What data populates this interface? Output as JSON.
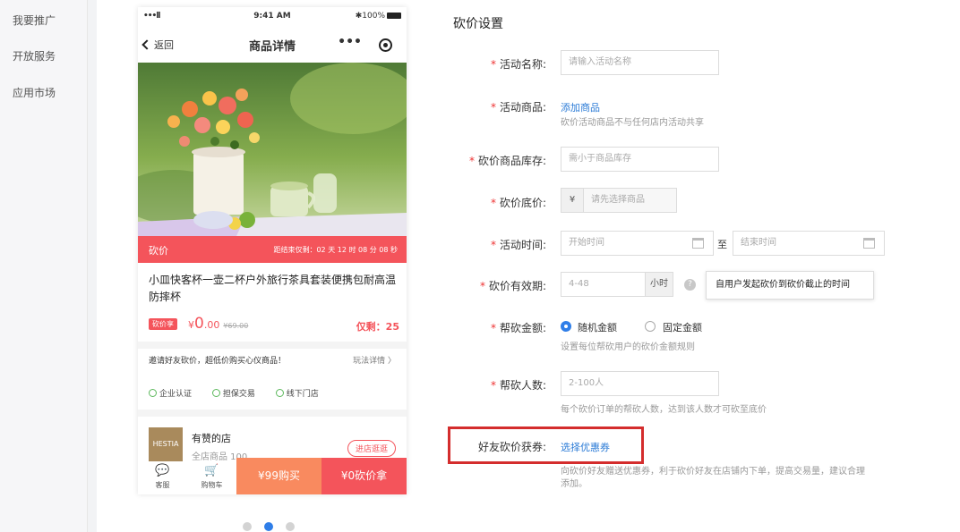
{
  "sidebar": {
    "items": [
      {
        "label": "我要推广"
      },
      {
        "label": "开放服务"
      },
      {
        "label": "应用市场"
      }
    ]
  },
  "phone": {
    "status": {
      "signal": "•••ll",
      "time": "9:41 AM",
      "battery": "✱100%"
    },
    "nav": {
      "back": "返回",
      "title": "商品详情",
      "more": "•••"
    },
    "bargain_bar": {
      "label": "砍价",
      "countdown": "距结束仅剩：02 天 12 时 08 分 08 秒"
    },
    "product_title": "小皿快客杯一壶二杯户外旅行茶具套装便携包耐高温防摔杯",
    "price": {
      "tag": "砍价享",
      "currency": "¥",
      "value": "0",
      "decimals": ".00",
      "original": "¥69.00"
    },
    "stock": "仅剩：25",
    "invite": {
      "text": "邀请好友砍价，超低价购买心仪商品！",
      "rule": "玩法详情  〉"
    },
    "badges": [
      "企业认证",
      "担保交易",
      "线下门店"
    ],
    "shop": {
      "logo": "HESTIA",
      "name": "有赞的店",
      "count": "全店商品 100",
      "button": "进店逛逛"
    },
    "bottom": {
      "service": "客服",
      "cart": "购物车",
      "buy_original": "¥99购买",
      "buy_bargain": "¥0砍价拿"
    }
  },
  "pager": {
    "count": 3,
    "active": 1
  },
  "form": {
    "title": "砍价设置",
    "activity_name": {
      "label": "活动名称:",
      "placeholder": "请输入活动名称"
    },
    "activity_product": {
      "label": "活动商品:",
      "link": "添加商品",
      "hint": "砍价活动商品不与任何店内活动共享"
    },
    "stock": {
      "label": "砍价商品库存:",
      "placeholder": "需小于商品库存"
    },
    "floor_price": {
      "label": "砍价底价:",
      "prefix": "¥",
      "placeholder": "请先选择商品"
    },
    "time": {
      "label": "活动时间:",
      "start": "开始时间",
      "to": "至",
      "end": "结束时间"
    },
    "validity": {
      "label": "砍价有效期:",
      "placeholder": "4-48",
      "unit": "小时",
      "help": "?",
      "tooltip": "自用户发起砍价到砍价截止的时间"
    },
    "amount": {
      "label": "帮砍金额:",
      "options": [
        "随机金额",
        "固定金额"
      ],
      "selected": 0,
      "hint": "设置每位帮砍用户的砍价金额规则"
    },
    "helpers": {
      "label": "帮砍人数:",
      "placeholder": "2-100人",
      "hint": "每个砍价订单的帮砍人数，达到该人数才可砍至底价"
    },
    "coupon": {
      "label": "好友砍价获券:",
      "link": "选择优惠券",
      "hint": [
        "向砍价好友赠送优惠券，利于砍价好友在店铺内下单，提高交易量，建议合理",
        "添加。"
      ]
    }
  },
  "colors": {
    "accent": "#f4545b",
    "link": "#2b7bd6",
    "highlight": "#d42d2d",
    "radio": "#2f7ee8"
  }
}
